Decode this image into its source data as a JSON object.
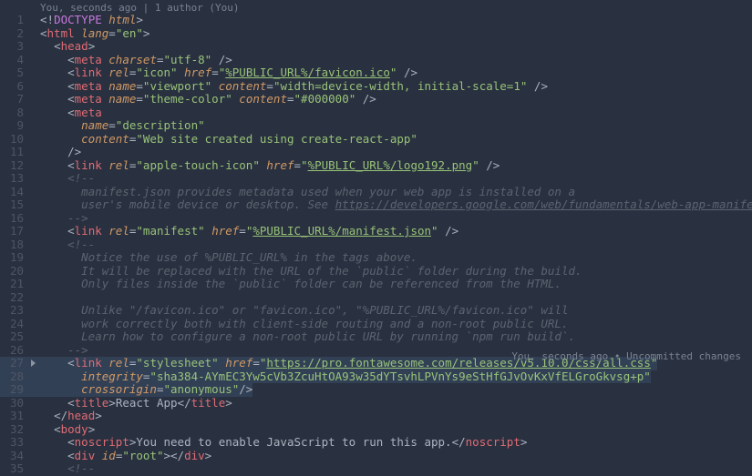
{
  "lens_top": "You, seconds ago | 1 author (You)",
  "lens_right_a": "You, seconds ago",
  "lens_right_b": "Uncommitted changes",
  "lines": [
    {
      "n": 1,
      "h": "<span class='punc'>&lt;!</span><span class='doct'>DOCTYPE</span> <span class='attr ital'>html</span><span class='punc'>&gt;</span>"
    },
    {
      "n": 2,
      "h": "<span class='punc'>&lt;</span><span class='tag'>html</span> <span class='attr'>lang</span><span class='punc'>=</span><span class='str'>\"en\"</span><span class='punc'>&gt;</span>"
    },
    {
      "n": 3,
      "h": "  <span class='punc'>&lt;</span><span class='tag'>head</span><span class='punc'>&gt;</span>"
    },
    {
      "n": 4,
      "h": "    <span class='punc'>&lt;</span><span class='tag'>meta</span> <span class='attr'>charset</span><span class='punc'>=</span><span class='str'>\"utf-8\"</span> <span class='punc'>/&gt;</span>"
    },
    {
      "n": 5,
      "h": "    <span class='punc'>&lt;</span><span class='tag'>link</span> <span class='attr'>rel</span><span class='punc'>=</span><span class='str'>\"icon\"</span> <span class='attr'>href</span><span class='punc'>=</span><span class='str'>\"</span><span class='link'>%PUBLIC_URL%/favicon.ico</span><span class='str'>\"</span> <span class='punc'>/&gt;</span>"
    },
    {
      "n": 6,
      "h": "    <span class='punc'>&lt;</span><span class='tag'>meta</span> <span class='attr'>name</span><span class='punc'>=</span><span class='str'>\"viewport\"</span> <span class='attr'>content</span><span class='punc'>=</span><span class='str'>\"width=device-width, initial-scale=1\"</span> <span class='punc'>/&gt;</span>"
    },
    {
      "n": 7,
      "h": "    <span class='punc'>&lt;</span><span class='tag'>meta</span> <span class='attr'>name</span><span class='punc'>=</span><span class='str'>\"theme-color\"</span> <span class='attr'>content</span><span class='punc'>=</span><span class='str'>\"#000000\"</span> <span class='punc'>/&gt;</span>"
    },
    {
      "n": 8,
      "h": "    <span class='punc'>&lt;</span><span class='tag'>meta</span>"
    },
    {
      "n": 9,
      "h": "      <span class='attr'>name</span><span class='punc'>=</span><span class='str'>\"description\"</span>"
    },
    {
      "n": 10,
      "h": "      <span class='attr'>content</span><span class='punc'>=</span><span class='str'>\"Web site created using create-react-app\"</span>"
    },
    {
      "n": 11,
      "h": "    <span class='punc'>/&gt;</span>"
    },
    {
      "n": 12,
      "h": "    <span class='punc'>&lt;</span><span class='tag'>link</span> <span class='attr'>rel</span><span class='punc'>=</span><span class='str'>\"apple-touch-icon\"</span> <span class='attr'>href</span><span class='punc'>=</span><span class='str'>\"</span><span class='link'>%PUBLIC_URL%/logo192.png</span><span class='str'>\"</span> <span class='punc'>/&gt;</span>"
    },
    {
      "n": 13,
      "h": "    <span class='cmt'>&lt;!--</span>"
    },
    {
      "n": 14,
      "h": "<span class='cmt'>      manifest.json provides metadata used when your web app is installed on a</span>"
    },
    {
      "n": 15,
      "h": "<span class='cmt'>      user's mobile device or desktop. See </span><span class='cmt' style='text-decoration:underline'>https://developers.google.com/web/fundamentals/web-app-manifest/</span>"
    },
    {
      "n": 16,
      "h": "<span class='cmt'>    --&gt;</span>"
    },
    {
      "n": 17,
      "h": "    <span class='punc'>&lt;</span><span class='tag'>link</span> <span class='attr'>rel</span><span class='punc'>=</span><span class='str'>\"manifest\"</span> <span class='attr'>href</span><span class='punc'>=</span><span class='str'>\"</span><span class='link'>%PUBLIC_URL%/manifest.json</span><span class='str'>\"</span> <span class='punc'>/&gt;</span>"
    },
    {
      "n": 18,
      "h": "    <span class='cmt'>&lt;!--</span>"
    },
    {
      "n": 19,
      "h": "<span class='cmt'>      Notice the use of %PUBLIC_URL% in the tags above.</span>"
    },
    {
      "n": 20,
      "h": "<span class='cmt'>      It will be replaced with the URL of the `public` folder during the build.</span>"
    },
    {
      "n": 21,
      "h": "<span class='cmt'>      Only files inside the `public` folder can be referenced from the HTML.</span>"
    },
    {
      "n": 22,
      "h": "<span class='cmt'> </span>"
    },
    {
      "n": 23,
      "h": "<span class='cmt'>      Unlike \"/favicon.ico\" or \"favicon.ico\", \"%PUBLIC_URL%/favicon.ico\" will</span>"
    },
    {
      "n": 24,
      "h": "<span class='cmt'>      work correctly both with client-side routing and a non-root public URL.</span>"
    },
    {
      "n": 25,
      "h": "<span class='cmt'>      Learn how to configure a non-root public URL by running `npm run build`.</span>"
    },
    {
      "n": 26,
      "h": "<span class='cmt'>    --&gt;</span>"
    },
    {
      "n": 27,
      "sel": true,
      "start": true,
      "h": "    <span class='punc'>&lt;</span><span class='tag'>link</span> <span class='attr'>rel</span><span class='punc'>=</span><span class='str'>\"stylesheet\"</span> <span class='attr'>href</span><span class='punc'>=</span><span class='str'>\"</span><span class='link'>https://pro.fontawesome.com/releases/v5.10.0/css/all.css</span><span class='str'>\"</span>"
    },
    {
      "n": 28,
      "sel": true,
      "h": "      <span class='attr'>integrity</span><span class='punc'>=</span><span class='str'>\"sha384-AYmEC3Yw5cVb3ZcuHtOA93w35dYTsvhLPVnYs9eStHfGJvOvKxVfELGroGkvsg+p\"</span>"
    },
    {
      "n": 29,
      "sel": true,
      "h": "      <span class='attr'>crossorigin</span><span class='punc'>=</span><span class='str'>\"anonymous\"</span><span class='punc'>/&gt;</span>"
    },
    {
      "n": 30,
      "h": "    <span class='punc'>&lt;</span><span class='tag'>title</span><span class='punc'>&gt;</span>React App<span class='punc'>&lt;/</span><span class='tag'>title</span><span class='punc'>&gt;</span>"
    },
    {
      "n": 31,
      "h": "  <span class='punc'>&lt;/</span><span class='tag'>head</span><span class='punc'>&gt;</span>"
    },
    {
      "n": 32,
      "h": "  <span class='punc'>&lt;</span><span class='tag'>body</span><span class='punc'>&gt;</span>"
    },
    {
      "n": 33,
      "h": "    <span class='punc'>&lt;</span><span class='tag'>noscript</span><span class='punc'>&gt;</span>You need to enable JavaScript to run this app.<span class='punc'>&lt;/</span><span class='tag'>noscript</span><span class='punc'>&gt;</span>"
    },
    {
      "n": 34,
      "h": "    <span class='punc'>&lt;</span><span class='tag'>div</span> <span class='attr'>id</span><span class='punc'>=</span><span class='str'>\"root\"</span><span class='punc'>&gt;&lt;/</span><span class='tag'>div</span><span class='punc'>&gt;</span>"
    },
    {
      "n": 35,
      "h": "    <span class='cmt'>&lt;!--</span>"
    }
  ]
}
